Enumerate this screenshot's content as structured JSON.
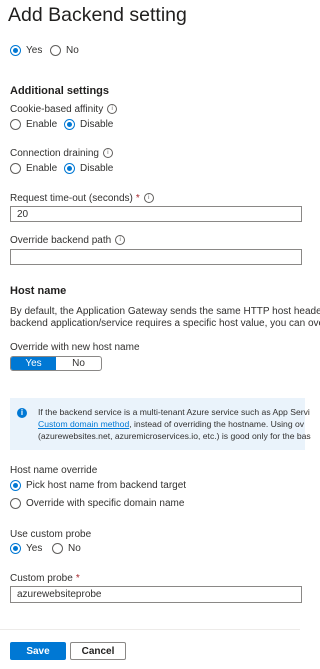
{
  "page": {
    "title": "Add Backend setting"
  },
  "top_radio": {
    "yes": "Yes",
    "no": "No"
  },
  "additional": {
    "heading": "Additional settings",
    "cookie": {
      "label": "Cookie-based affinity",
      "enable": "Enable",
      "disable": "Disable"
    },
    "draining": {
      "label": "Connection draining",
      "enable": "Enable",
      "disable": "Disable"
    },
    "timeout": {
      "label": "Request time-out (seconds)",
      "required": "*",
      "value": "20"
    },
    "path": {
      "label": "Override backend path",
      "value": ""
    }
  },
  "hostname": {
    "heading": "Host name",
    "desc_line1": "By default, the Application Gateway sends the same HTTP host header to",
    "desc_line2": "backend application/service requires a specific host value, you can overr",
    "override_label": "Override with new host name",
    "toggle_yes": "Yes",
    "toggle_no": "No",
    "info_line1": "If the backend service is a multi-tenant Azure service such as App Servi",
    "info_link": "Custom domain method",
    "info_line2_rest": ", instead of overriding the hostname. Using ov",
    "info_line3": "(azurewebsites.net, azuremicroservices.io, etc.) is good only for the bas",
    "override_section_label": "Host name override",
    "pick_option": "Pick host name from backend target",
    "specific_option": "Override with specific domain name",
    "custom_probe_label": "Use custom probe",
    "probe_yes": "Yes",
    "probe_no": "No",
    "custom_probe_field_label": "Custom probe",
    "custom_probe_required": "*",
    "custom_probe_value": "azurewebsiteprobe"
  },
  "footer": {
    "save": "Save",
    "cancel": "Cancel"
  },
  "colors": {
    "accent": "#0078d4",
    "info_bg": "#eaf3fb",
    "required": "#a4262c"
  }
}
